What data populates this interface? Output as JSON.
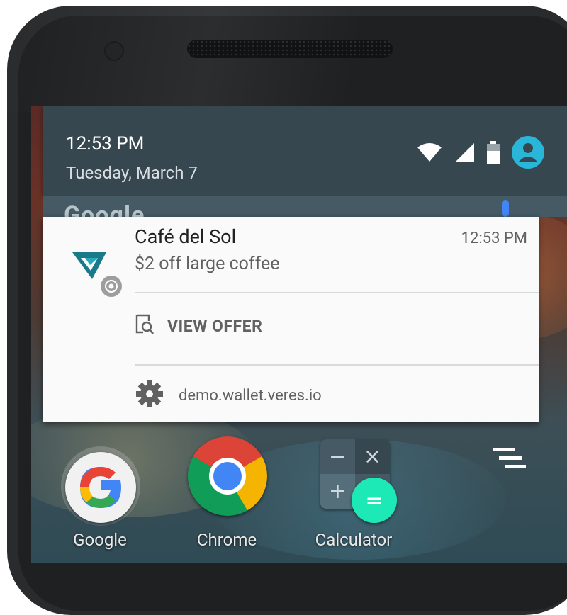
{
  "status": {
    "time": "12:53 PM",
    "date": "Tuesday, March 7",
    "icons": [
      "wifi-icon",
      "cell-signal-icon",
      "battery-icon",
      "account-icon"
    ]
  },
  "google_bar": {
    "text": "Google"
  },
  "notification": {
    "app_icon": "veres-wallet-logo-icon",
    "badge_icon": "chrome-badge-icon",
    "title": "Café del Sol",
    "time": "12:53 PM",
    "body": "$2 off large coffee",
    "action": {
      "icon": "search-document-icon",
      "label": "VIEW OFFER"
    },
    "settings": {
      "icon": "gear-icon",
      "label": "demo.wallet.veres.io"
    }
  },
  "apps": [
    {
      "name": "Google",
      "icon": "google-icon"
    },
    {
      "name": "Chrome",
      "icon": "chrome-icon"
    },
    {
      "name": "Calculator",
      "icon": "calculator-icon"
    }
  ],
  "colors": {
    "status_panel": "#37474f",
    "card": "#fafafa",
    "accent_teal": "#1a7a8a",
    "account": "#29b6d9"
  }
}
